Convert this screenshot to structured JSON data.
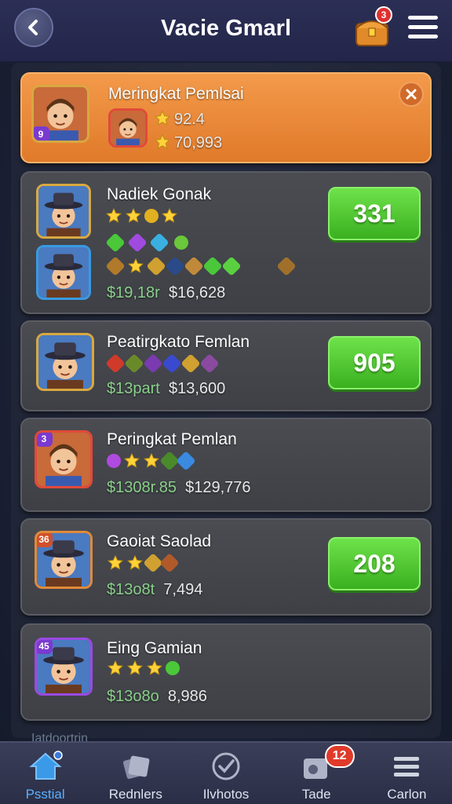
{
  "header": {
    "title": "Vacie Gmarl",
    "back_icon": "back-arrow-icon",
    "chest_badge": "3",
    "menu_icon": "hamburger-icon"
  },
  "players": [
    {
      "name": "Meringkat Pemlsai",
      "stat1": "92.4",
      "stat2": "70,993",
      "level": "9",
      "highlight": true
    },
    {
      "name": "Nadiek Gonak",
      "stat1": "$19,18r",
      "stat2": "$16,628",
      "score": "331"
    },
    {
      "name": "Peatirgkato Femlan",
      "stat1": "$13part",
      "stat2": "$13,600",
      "score": "905"
    },
    {
      "name": "Peringkat Pemlan",
      "stat1": "$1308r.85",
      "stat2": "$129,776",
      "level": "3"
    },
    {
      "name": "Gaoiat Saolad",
      "stat1": "$13o8t",
      "stat2": "7,494",
      "score": "208",
      "level": "36"
    },
    {
      "name": "Eing Gamian",
      "stat1": "$13o8o",
      "stat2": "8,986",
      "level": "45"
    }
  ],
  "bottom_peek": "Iatdoortrin",
  "tabs": [
    {
      "label": "Psstial",
      "icon": "home-icon",
      "active": true
    },
    {
      "label": "Rednlers",
      "icon": "cards-icon"
    },
    {
      "label": "Ilvhotos",
      "icon": "check-icon"
    },
    {
      "label": "Tade",
      "icon": "tag-icon",
      "badge": "12"
    },
    {
      "label": "Carlon",
      "icon": "menu-icon"
    }
  ],
  "colors": {
    "accent_orange": "#f39a4a",
    "score_green": "#4ac82a",
    "badge_red": "#e03a2a",
    "active_tab": "#5ab0ff"
  }
}
